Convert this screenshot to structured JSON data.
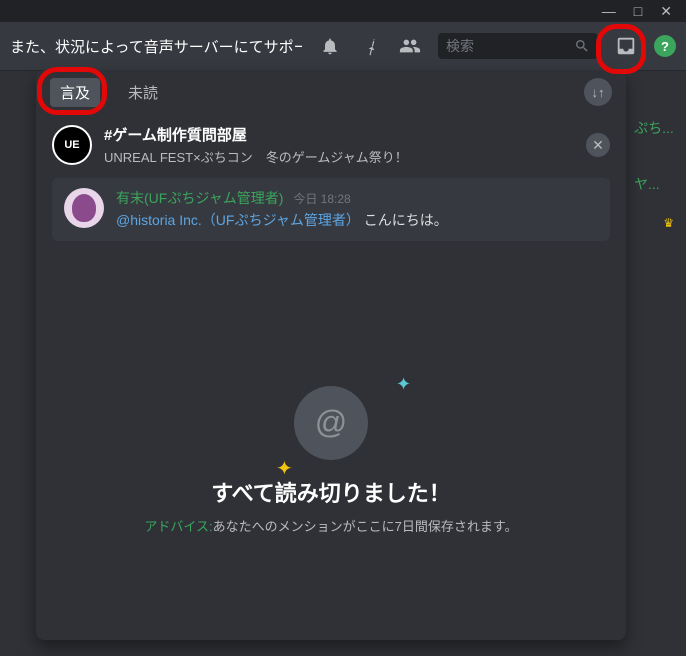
{
  "titlebar": {
    "min": "—",
    "max": "□",
    "close": "✕"
  },
  "header": {
    "title": "また、状況によって音声サーバーにてサポートい...",
    "search_placeholder": "検索"
  },
  "tabs": {
    "mentions": "言及",
    "unread": "未読"
  },
  "channel": {
    "avatar_text": "UE",
    "name": "#ゲーム制作質問部屋",
    "subtitle": "UNREAL FEST×ぷちコン　冬のゲームジャム祭り！"
  },
  "message": {
    "author": "有末(UFぷちジャム管理者)",
    "timestamp": "今日 18:28",
    "mention": "@historia Inc.（UFぷちジャム管理者）",
    "text": " こんにちは。"
  },
  "empty": {
    "title": "すべて読み切りました！",
    "advice_label": "アドバイス:",
    "advice_text": "あなたへのメンションがここに7日間保存されます。"
  },
  "side": {
    "item1": "ぷち...",
    "item2": "ヤ..."
  }
}
